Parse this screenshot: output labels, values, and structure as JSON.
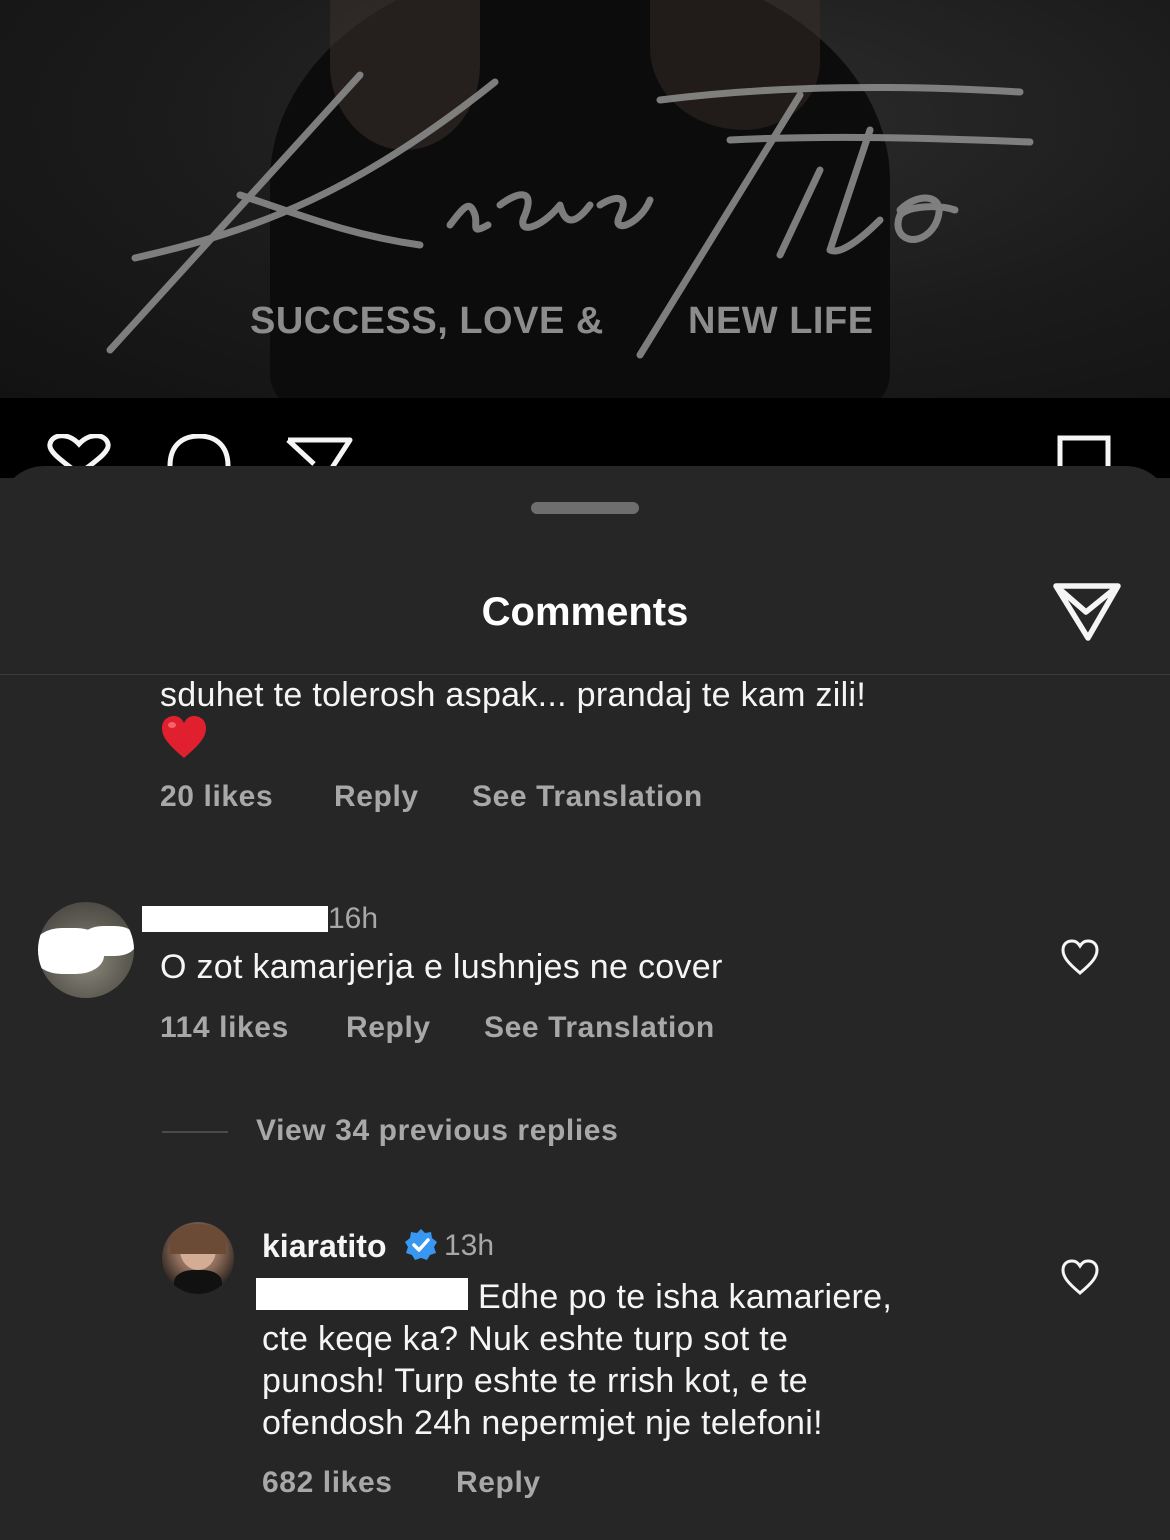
{
  "post": {
    "signature_text": "Kiara Tito",
    "tagline_left": "SUCCESS, LOVE &",
    "tagline_right": "NEW LIFE"
  },
  "sheet": {
    "title": "Comments"
  },
  "comments": [
    {
      "text": "sduhet te tolerosh aspak... prandaj te kam zili!",
      "emoji": "red-heart-emoji",
      "likes": "20 likes",
      "reply": "Reply",
      "translate": "See Translation"
    },
    {
      "time": "16h",
      "text": "O zot kamarjerja e lushnjes ne cover",
      "likes": "114 likes",
      "reply": "Reply",
      "translate": "See Translation"
    }
  ],
  "view_replies": "View 34 previous replies",
  "reply": {
    "username": "kiaratito",
    "verified": true,
    "time": "13h",
    "lines": [
      "Edhe po te isha kamariere,",
      "cte keqe ka? Nuk eshte turp sot te",
      "punosh! Turp eshte te rrish kot, e te",
      "ofendosh 24h nepermjet nje telefoni!"
    ],
    "likes": "682 likes",
    "reply_label": "Reply"
  },
  "colors": {
    "sheet_bg": "#262626",
    "secondary_text": "#a8a8a8",
    "verified_blue": "#3897f0"
  }
}
